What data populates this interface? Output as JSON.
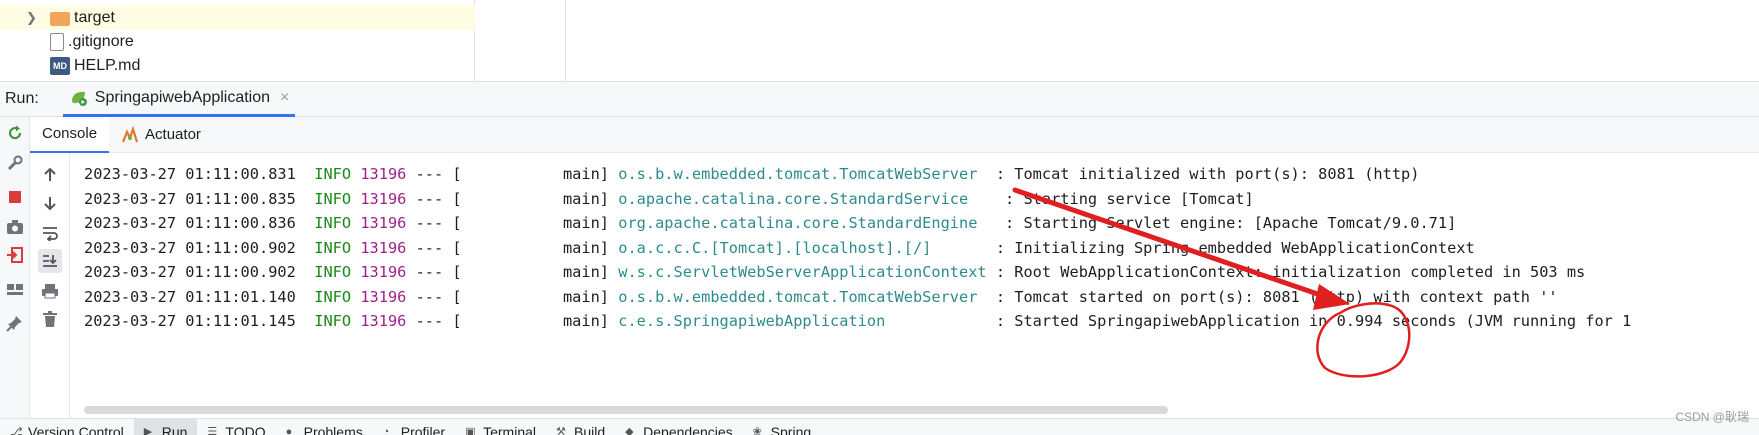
{
  "tree": {
    "items": [
      {
        "label": "target",
        "icon": "folder-icon",
        "expandable": true,
        "selected": true
      },
      {
        "label": ".gitignore",
        "icon": "file-icon",
        "expandable": false,
        "selected": false
      },
      {
        "label": "HELP.md",
        "icon": "markdown-file-icon",
        "expandable": false,
        "selected": false
      }
    ]
  },
  "run": {
    "label": "Run:",
    "tab_label": "SpringapiwebApplication",
    "close_glyph": "×"
  },
  "console_tabs": [
    {
      "label": "Console",
      "active": true
    },
    {
      "label": "Actuator",
      "active": false
    }
  ],
  "log": {
    "lines": [
      {
        "ts": "2023-03-27 01:11:00.831",
        "level": "INFO",
        "pid": "13196",
        "sep": "--- [",
        "thread": "           main]",
        "logger": "o.s.b.w.embedded.tomcat.TomcatWebServer ",
        "msg": " : Tomcat initialized with port(s): 8081 (http)"
      },
      {
        "ts": "2023-03-27 01:11:00.835",
        "level": "INFO",
        "pid": "13196",
        "sep": "--- [",
        "thread": "           main]",
        "logger": "o.apache.catalina.core.StandardService   ",
        "msg": " : Starting service [Tomcat]"
      },
      {
        "ts": "2023-03-27 01:11:00.836",
        "level": "INFO",
        "pid": "13196",
        "sep": "--- [",
        "thread": "           main]",
        "logger": "org.apache.catalina.core.StandardEngine  ",
        "msg": " : Starting Servlet engine: [Apache Tomcat/9.0.71]"
      },
      {
        "ts": "2023-03-27 01:11:00.902",
        "level": "INFO",
        "pid": "13196",
        "sep": "--- [",
        "thread": "           main]",
        "logger": "o.a.c.c.C.[Tomcat].[localhost].[/]      ",
        "msg": " : Initializing Spring embedded WebApplicationContext"
      },
      {
        "ts": "2023-03-27 01:11:00.902",
        "level": "INFO",
        "pid": "13196",
        "sep": "--- [",
        "thread": "           main]",
        "logger": "w.s.c.ServletWebServerApplicationContext",
        "msg": " : Root WebApplicationContext: initialization completed in 503 ms"
      },
      {
        "ts": "2023-03-27 01:11:01.140",
        "level": "INFO",
        "pid": "13196",
        "sep": "--- [",
        "thread": "           main]",
        "logger": "o.s.b.w.embedded.tomcat.TomcatWebServer ",
        "msg": " : Tomcat started on port(s): 8081 (http) with context path ''"
      },
      {
        "ts": "2023-03-27 01:11:01.145",
        "level": "INFO",
        "pid": "13196",
        "sep": "--- [",
        "thread": "           main]",
        "logger": "c.e.s.SpringapiwebApplication           ",
        "msg": " : Started SpringapiwebApplication in 0.994 seconds (JVM running for 1"
      }
    ]
  },
  "bottom_bar": {
    "items": [
      {
        "label": "Version Control",
        "icon": "version-control-icon",
        "active": false
      },
      {
        "label": "Run",
        "icon": "run-icon",
        "active": true
      },
      {
        "label": "TODO",
        "icon": "todo-icon",
        "active": false
      },
      {
        "label": "Problems",
        "icon": "problems-icon",
        "active": false
      },
      {
        "label": "Profiler",
        "icon": "profiler-icon",
        "active": false
      },
      {
        "label": "Terminal",
        "icon": "terminal-icon",
        "active": false
      },
      {
        "label": "Build",
        "icon": "build-icon",
        "active": false
      },
      {
        "label": "Dependencies",
        "icon": "dependencies-icon",
        "active": false
      },
      {
        "label": "Spring",
        "icon": "spring-icon",
        "active": false
      }
    ]
  },
  "watermark": "CSDN @耿瑞",
  "colors": {
    "info": "#1a8a1a",
    "pid": "#a0208a",
    "logger": "#2e8b8b",
    "annotation": "#e02020",
    "accent": "#3574f0"
  }
}
